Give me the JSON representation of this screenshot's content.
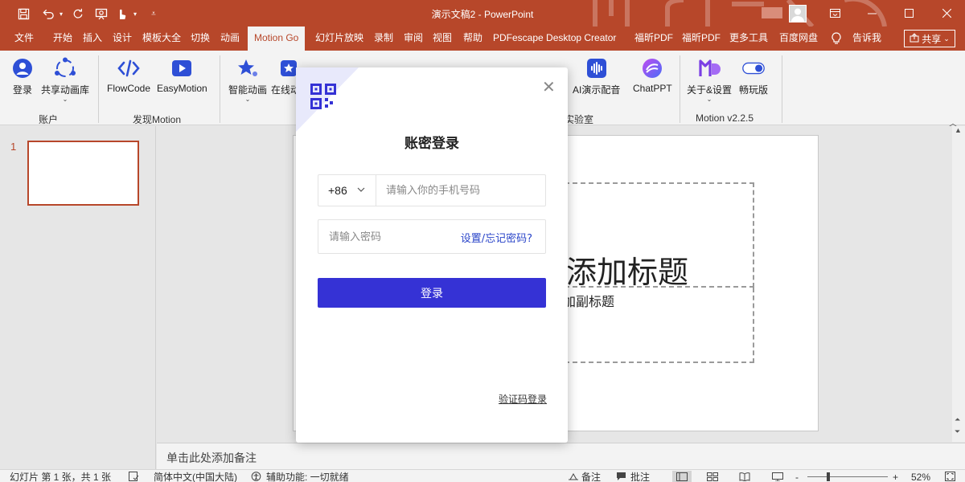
{
  "titlebar": {
    "title": "演示文稿2  -  PowerPoint",
    "share": "共享"
  },
  "tabs": [
    "文件",
    "开始",
    "插入",
    "设计",
    "模板大全",
    "切换",
    "动画",
    "Motion Go",
    "幻灯片放映",
    "录制",
    "审阅",
    "视图",
    "帮助",
    "PDFescape Desktop Creator",
    "福昕PDF",
    "福昕PDF",
    "更多工具",
    "百度网盘",
    "告诉我"
  ],
  "ribbon": {
    "buttons": {
      "login": "登录",
      "share_lib": "共享动画库",
      "flowcode": "FlowCode",
      "easymotion": "EasyMotion",
      "smart_anim": "智能动画",
      "online": "在线动",
      "voice_partial": "I",
      "ai_voice": "AI演示配音",
      "chatppt": "ChatPPT",
      "about": "关于&设置",
      "play": "畅玩版"
    },
    "groups": {
      "account": "账户",
      "discover": "发现Motion",
      "lab": "实验室",
      "version": "Motion v2.2.5"
    }
  },
  "thumbs": {
    "slide_number": "1"
  },
  "slide": {
    "title_placeholder": "添加标题",
    "subtitle_placeholder": "加副标题"
  },
  "notes": {
    "placeholder": "单击此处添加备注"
  },
  "status": {
    "slide_info": "幻灯片 第 1 张，共 1 张",
    "language": "简体中文(中国大陆)",
    "accessibility": "辅助功能: 一切就绪",
    "notes": "备注",
    "comments": "批注",
    "zoom": "52%"
  },
  "modal": {
    "title": "账密登录",
    "country_code": "+86",
    "phone_placeholder": "请输入你的手机号码",
    "password_placeholder": "请输入密码",
    "forgot": "设置/忘记密码?",
    "login_button": "登录",
    "code_login": "验证码登录"
  },
  "colors": {
    "brand": "#b7472a",
    "accent": "#3532d5",
    "link": "#2a45c9"
  }
}
